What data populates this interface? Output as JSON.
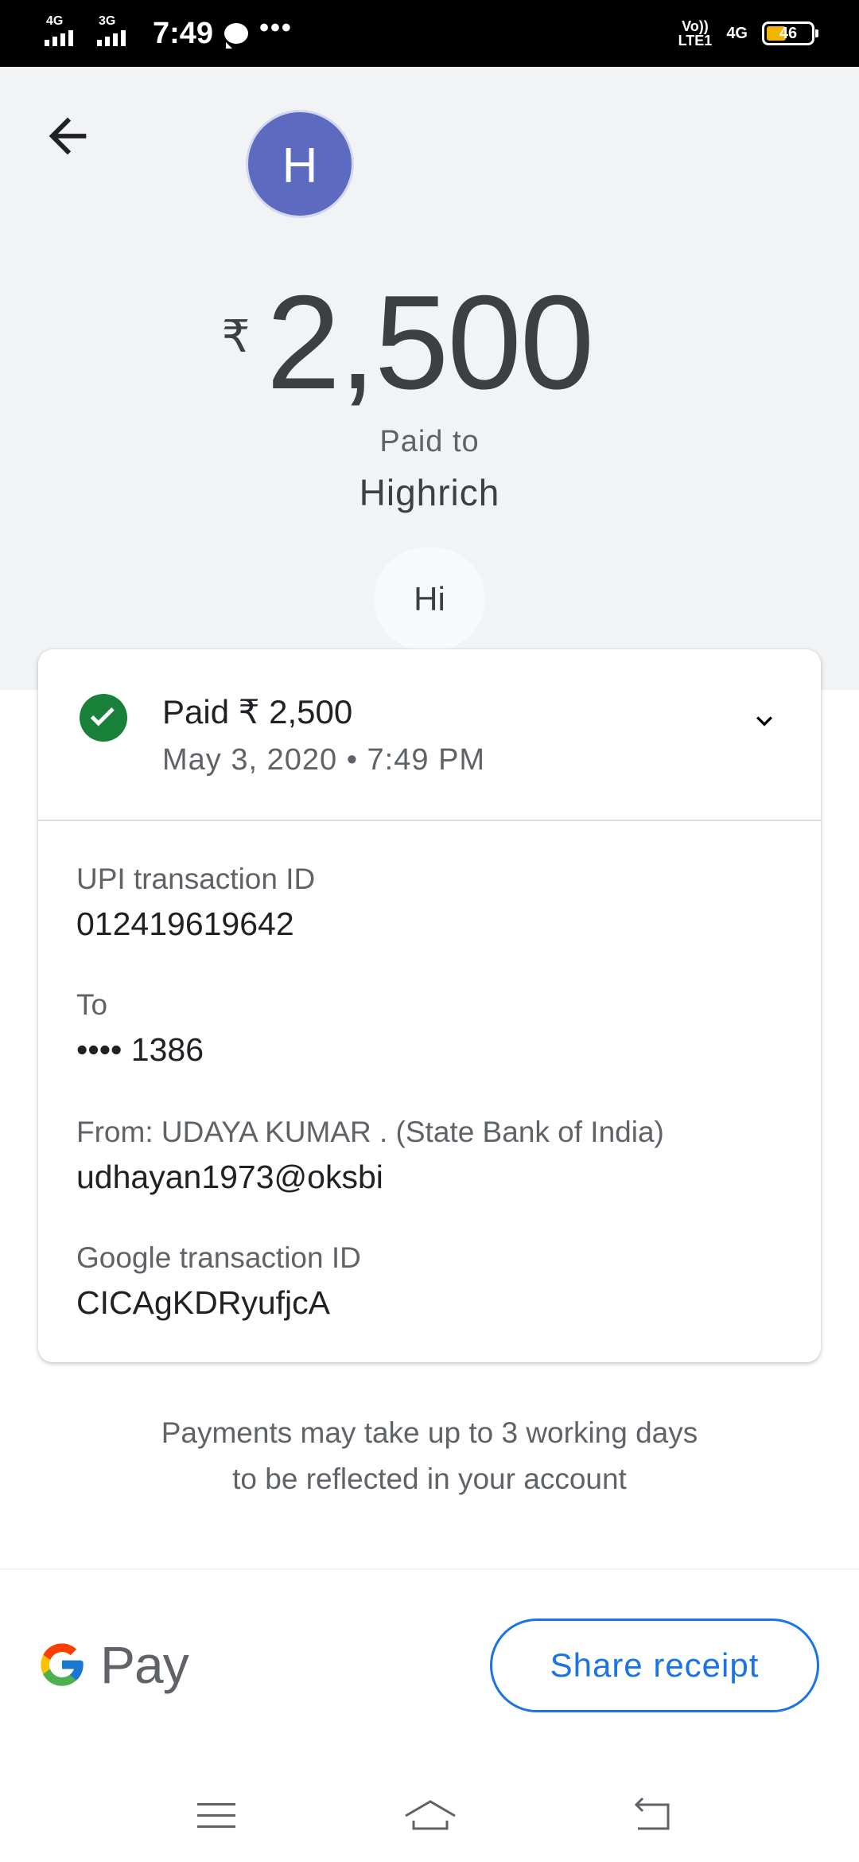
{
  "status_bar": {
    "sim1_network": "4G",
    "sim2_network": "3G",
    "time": "7:49",
    "more_indicator": "•••",
    "volte_top": "Vo))",
    "volte_bottom": "LTE1",
    "data_network": "4G",
    "battery_level": "46"
  },
  "header": {
    "avatar_initial": "H",
    "avatar_color": "#5c6bc0",
    "currency_symbol": "₹",
    "amount": "2,500",
    "paid_to_label": "Paid to",
    "payee_name": "Highrich",
    "note": "Hi"
  },
  "transaction": {
    "status_text": "Paid ₹ 2,500",
    "status_color": "#188038",
    "date_time": "May 3, 2020 • 7:49 PM",
    "details": [
      {
        "label": "UPI transaction ID",
        "value": "012419619642"
      },
      {
        "label": "To",
        "value": "•••• 1386"
      },
      {
        "label": "From: UDAYA KUMAR  . (State Bank of India)",
        "value": "udhayan1973@oksbi"
      },
      {
        "label": "Google transaction ID",
        "value": "CICAgKDRyufjcA"
      }
    ]
  },
  "footer": {
    "info_line1": "Payments may take up to 3 working days",
    "info_line2": "to be reflected in your account",
    "brand_text": "Pay",
    "share_label": "Share receipt",
    "accent_color": "#1a73e8"
  },
  "icons": [
    "back-arrow-icon",
    "check-circle-icon",
    "chevron-down-icon",
    "google-g-icon",
    "menu-icon",
    "home-icon",
    "back-icon"
  ]
}
